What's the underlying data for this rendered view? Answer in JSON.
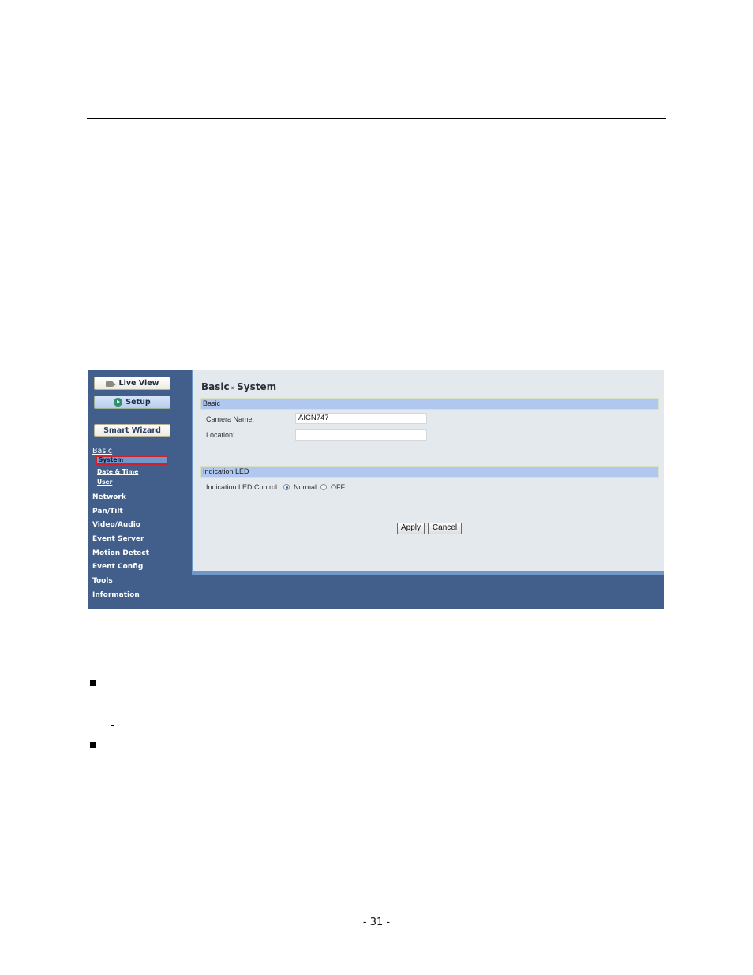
{
  "screenshot": {
    "sidebar": {
      "buttons": [
        {
          "label": "Live View",
          "icon": "video-camera-icon"
        },
        {
          "label": "Setup",
          "icon": "setup-play-icon"
        },
        {
          "label": "Smart Wizard"
        }
      ],
      "nav": {
        "basic": "Basic",
        "basic_items": [
          "System",
          "Date & Time",
          "User"
        ],
        "active_item": "System",
        "categories": [
          "Network",
          "Pan/Tilt",
          "Video/Audio",
          "Event Server",
          "Motion Detect",
          "Event Config",
          "Tools",
          "Information"
        ]
      }
    },
    "main": {
      "title_part1": "Basic",
      "title_sep": "»",
      "title_part2": "System",
      "sections": {
        "basic": {
          "header": "Basic",
          "camera_name_label": "Camera Name:",
          "camera_name_value": "AICN747",
          "location_label": "Location:",
          "location_value": ""
        },
        "led": {
          "header": "Indication LED",
          "control_label": "Indication LED Control:",
          "options": [
            "Normal",
            "OFF"
          ],
          "selected": "Normal"
        }
      },
      "buttons": {
        "apply": "Apply",
        "cancel": "Cancel"
      }
    }
  },
  "document": {
    "bullet_markers": [
      "■",
      "-",
      "-",
      "■"
    ],
    "page_number": "- 31 -"
  }
}
